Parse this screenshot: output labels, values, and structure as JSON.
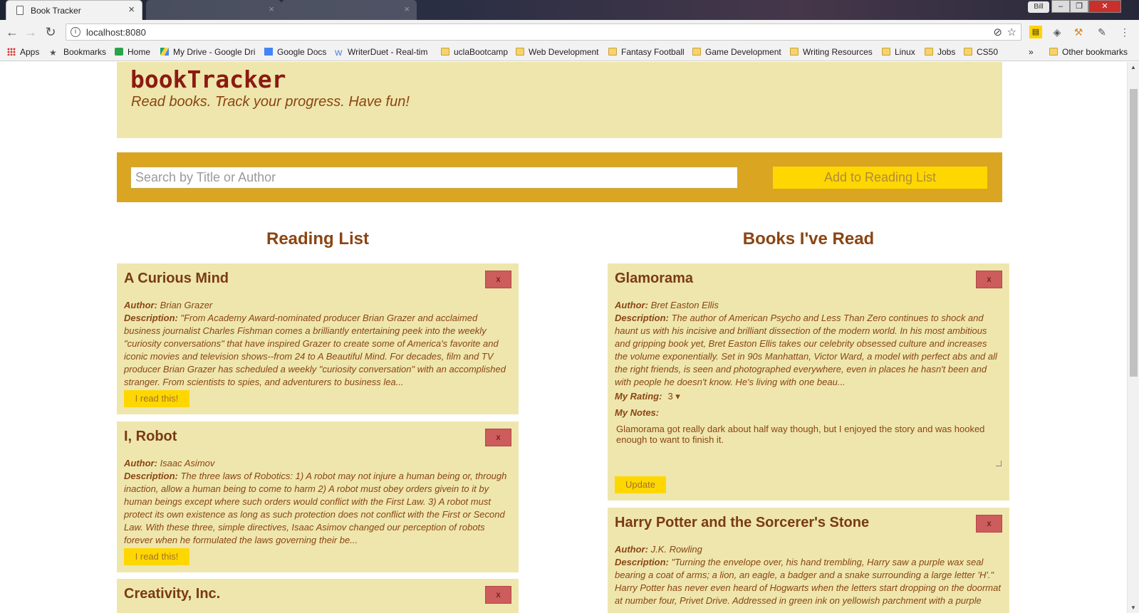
{
  "browser": {
    "active_tab_title": "Book Tracker",
    "url": "localhost:8080",
    "profile_name": "Bill",
    "bookmarks": [
      {
        "label": "Apps",
        "icon": "apps-grid-icon"
      },
      {
        "label": "Bookmarks",
        "icon": "star-icon"
      },
      {
        "label": "Home",
        "icon": "home-icon"
      },
      {
        "label": "My Drive - Google Dri",
        "icon": "google-drive-icon"
      },
      {
        "label": "Google Docs",
        "icon": "google-docs-icon"
      },
      {
        "label": "WriterDuet - Real-tim",
        "icon": "writerduet-icon"
      },
      {
        "label": "uclaBootcamp",
        "icon": "folder-icon"
      },
      {
        "label": "Web Development",
        "icon": "folder-icon"
      },
      {
        "label": "Fantasy Football",
        "icon": "folder-icon"
      },
      {
        "label": "Game Development",
        "icon": "folder-icon"
      },
      {
        "label": "Writing Resources",
        "icon": "folder-icon"
      },
      {
        "label": "Linux",
        "icon": "folder-icon"
      },
      {
        "label": "Jobs",
        "icon": "folder-icon"
      },
      {
        "label": "CS50",
        "icon": "folder-icon"
      }
    ],
    "overflow_label": "»",
    "other_bookmarks": "Other bookmarks"
  },
  "app": {
    "name": "bookTracker",
    "tagline": "Read books. Track your progress. Have fun!",
    "search_placeholder": "Search by Title or Author",
    "add_button": "Add to Reading List"
  },
  "reading_list": {
    "heading": "Reading List",
    "books": [
      {
        "title": "A Curious Mind",
        "author_label": "Author:",
        "author": "Brian Grazer",
        "description_label": "Description:",
        "description": "\"From Academy Award-nominated producer Brian Grazer and acclaimed business journalist Charles Fishman comes a brilliantly entertaining peek into the weekly \"curiosity conversations\" that have inspired Grazer to create some of America's favorite and iconic movies and television shows--from 24 to A Beautiful Mind. For decades, film and TV producer Brian Grazer has scheduled a weekly \"curiosity conversation\" with an accomplished stranger. From scientists to spies, and adventurers to business lea...",
        "action": "I read this!",
        "delete": "x"
      },
      {
        "title": "I, Robot",
        "author_label": "Author:",
        "author": "Isaac Asimov",
        "description_label": "Description:",
        "description": "The three laws of Robotics: 1) A robot may not injure a human being or, through inaction, allow a human being to come to harm 2) A robot must obey orders givein to it by human beings except where such orders would conflict with the First Law. 3) A robot must protect its own existence as long as such protection does not conflict with the First or Second Law. With these three, simple directives, Isaac Asimov changed our perception of robots forever when he formulated the laws governing their be...",
        "action": "I read this!",
        "delete": "x"
      },
      {
        "title": "Creativity, Inc.",
        "delete": "x"
      }
    ]
  },
  "read_books": {
    "heading": "Books I've Read",
    "books": [
      {
        "title": "Glamorama",
        "author_label": "Author:",
        "author": "Bret Easton Ellis",
        "description_label": "Description:",
        "description": "The author of American Psycho and Less Than Zero continues to shock and haunt us with his incisive and brilliant dissection of the modern world. In his most ambitious and gripping book yet, Bret Easton Ellis takes our celebrity obsessed culture and increases the volume exponentially. Set in 90s Manhattan, Victor Ward, a model with perfect abs and all the right friends, is seen and photographed everywhere, even in places he hasn't been and with people he doesn't know. He's living with one beau...",
        "rating_label": "My Rating:",
        "rating": "3 ▾",
        "notes_label": "My Notes:",
        "notes": "Glamorama got really dark about half way though, but I enjoyed the story and was hooked enough to want to finish it.",
        "update": "Update",
        "delete": "x"
      },
      {
        "title": "Harry Potter and the Sorcerer's Stone",
        "author_label": "Author:",
        "author": "J.K. Rowling",
        "description_label": "Description:",
        "description": "\"Turning the envelope over, his hand trembling, Harry saw a purple wax seal bearing a coat of arms; a lion, an eagle, a badger and a snake surrounding a large letter 'H'.\" Harry Potter has never even heard of Hogwarts when the letters start dropping on the doormat at number four, Privet Drive. Addressed in green ink on yellowish parchment with a purple",
        "delete": "x"
      }
    ]
  },
  "colors": {
    "panel": "#eee6ad",
    "search_bar": "#daa521",
    "button": "#ffd700",
    "delete": "#cd5c5c",
    "text_brown": "#8b4513",
    "title_red": "#8b1a12"
  }
}
